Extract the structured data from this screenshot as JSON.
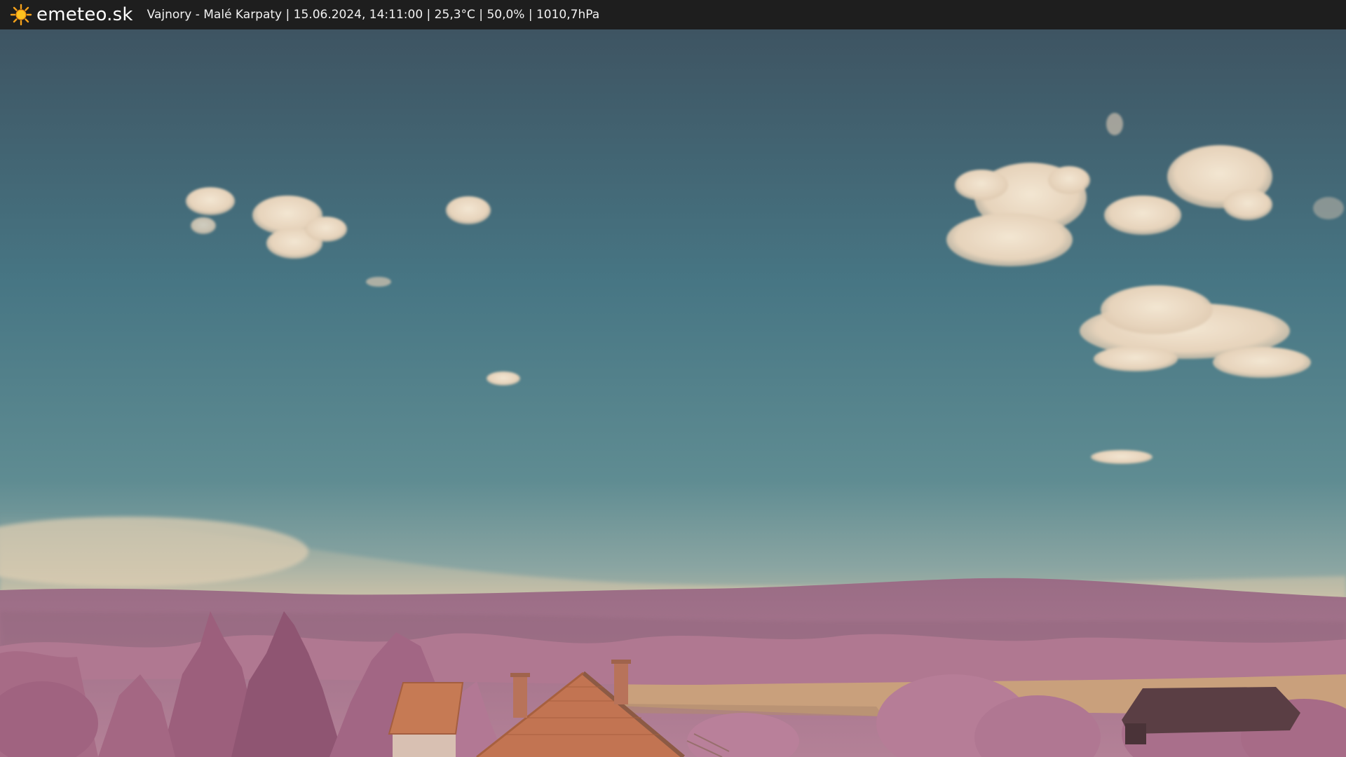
{
  "header": {
    "brand": "emeteo.sk",
    "caption": "Vajnory - Malé Karpaty | 15.06.2024, 14:11:00 | 25,3°C | 50,0% | 1010,7hPa",
    "logo_icon": "sun-icon"
  },
  "colors": {
    "bar_background": "#1e1e1e",
    "sky_top": "#3f5766",
    "sky_mid": "#4c7c88",
    "sky_horizon": "#9fb0a8",
    "haze": "#cbbfa5",
    "hills": "#9c6f86",
    "foliage": "#b27a92",
    "field": "#c9a07c",
    "roof": "#c67a54",
    "cloud": "#ecdcc6"
  }
}
